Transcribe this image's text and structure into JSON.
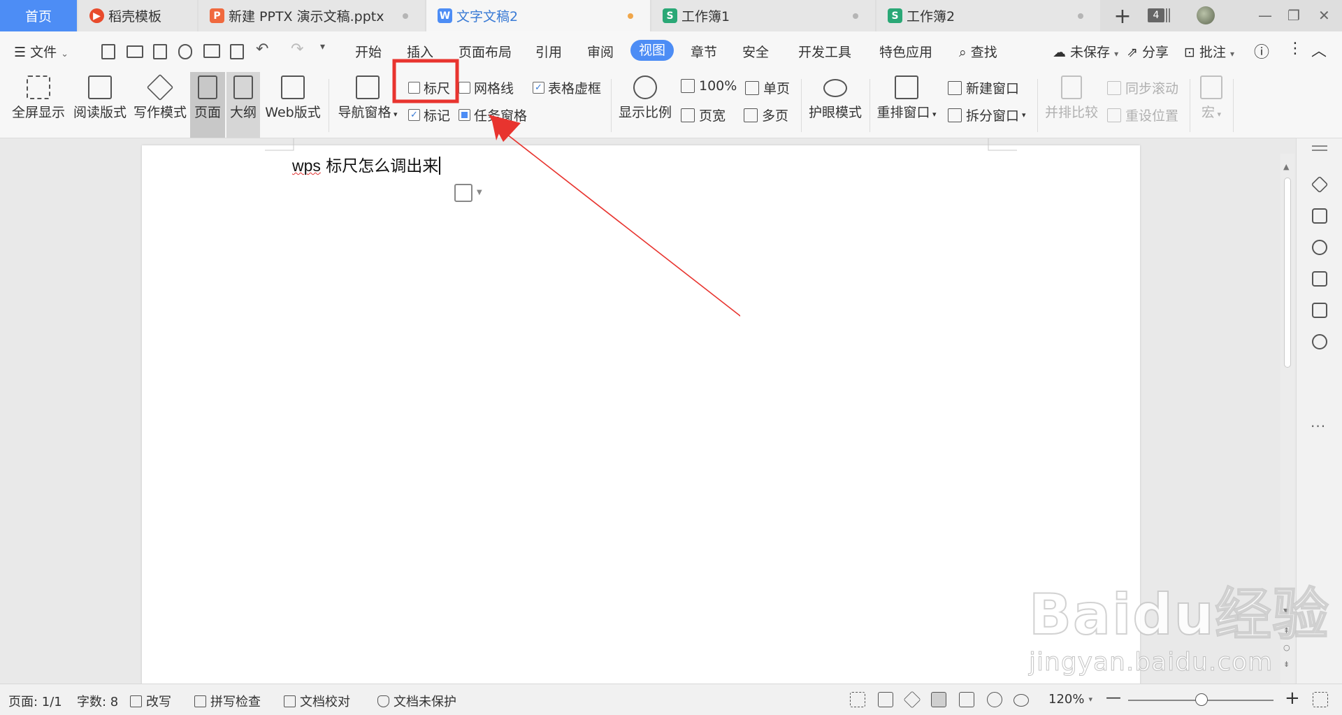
{
  "tabs": {
    "home": "首页",
    "docer": "稻壳模板",
    "pptx": "新建 PPTX 演示文稿.pptx",
    "doc2": "文字文稿2",
    "book1": "工作簿1",
    "book2": "工作簿2",
    "add": "+",
    "count": "4"
  },
  "window": {
    "minimize": "—",
    "restore": "❐",
    "close": "✕"
  },
  "menu": {
    "file": "文件",
    "start": "开始",
    "insert": "插入",
    "layout": "页面布局",
    "reference": "引用",
    "review": "审阅",
    "view": "视图",
    "chapter": "章节",
    "security": "安全",
    "devtools": "开发工具",
    "special": "特色应用",
    "find": "查找",
    "unsaved": "未保存",
    "share": "分享",
    "annotate": "批注"
  },
  "ribbon": {
    "fullscreen": "全屏显示",
    "reading": "阅读版式",
    "writing": "写作模式",
    "page": "页面",
    "outline": "大纲",
    "web": "Web版式",
    "navpane": "导航窗格",
    "ruler": "标尺",
    "gridlines": "网格线",
    "table_gridlines": "表格虚框",
    "marks": "标记",
    "taskpane": "任务窗格",
    "zoom": "显示比例",
    "zoom100": "100%",
    "single_page": "单页",
    "page_width": "页宽",
    "multi_page": "多页",
    "eyecare": "护眼模式",
    "arrange": "重排窗口",
    "new_window": "新建窗口",
    "split_window": "拆分窗口",
    "side_by_side": "并排比较",
    "sync_scroll": "同步滚动",
    "reset_position": "重设位置",
    "macro": "宏"
  },
  "document": {
    "word1": "wps",
    "rest": " 标尺怎么调出来"
  },
  "status": {
    "page": "页面: 1/1",
    "words": "字数: 8",
    "overtype": "改写",
    "spellcheck": "拼写检查",
    "proofread": "文档校对",
    "protection": "文档未保护",
    "zoom": "120%",
    "zoom_minus": "—",
    "zoom_plus": "+"
  },
  "watermark": {
    "logo": "Baidu经验",
    "url": "jingyan.baidu.com"
  },
  "colors": {
    "accent": "#4d8df5",
    "annotation_red": "#e8342f"
  }
}
